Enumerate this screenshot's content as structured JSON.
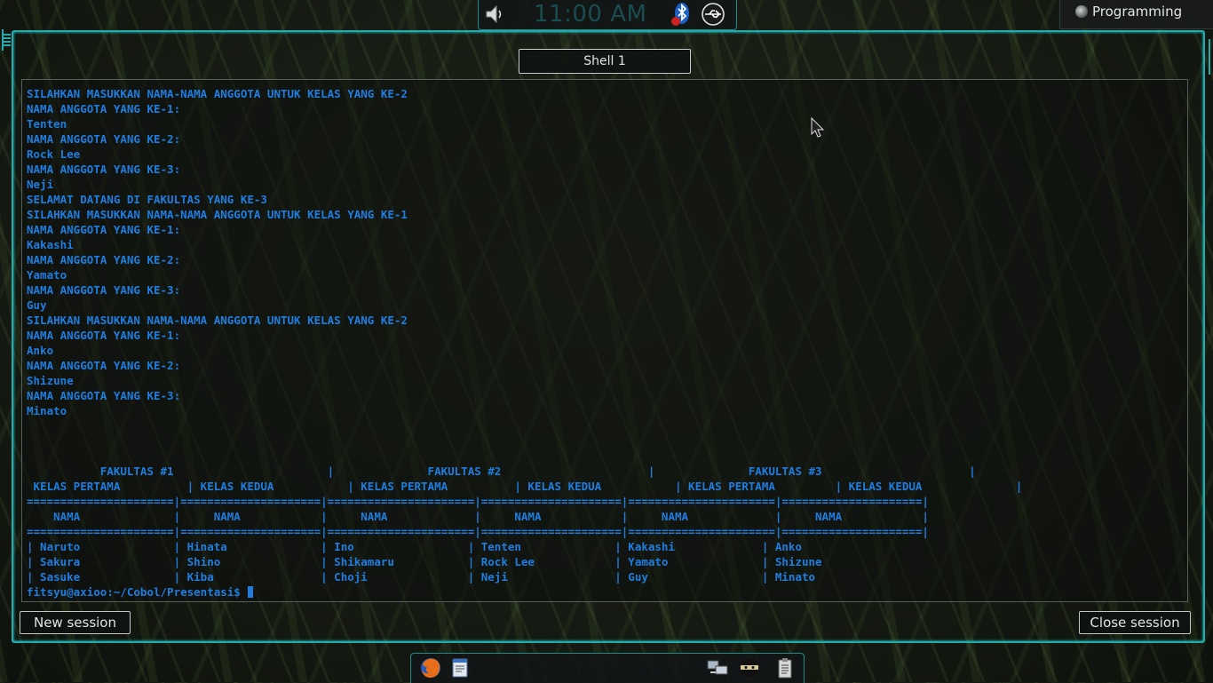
{
  "top_panel": {
    "clock": "11:00 AM",
    "icons": [
      "speaker-icon",
      "bluetooth-icon",
      "usb-icon"
    ]
  },
  "workspace": {
    "label": "Programming"
  },
  "konsole": {
    "tab_title": "Shell 1",
    "new_session_label": "New session",
    "close_session_label": "Close session",
    "terminal_output": "SILAHKAN MASUKKAN NAMA-NAMA ANGGOTA UNTUK KELAS YANG KE-2\nNAMA ANGGOTA YANG KE-1:\nTenten\nNAMA ANGGOTA YANG KE-2:\nRock Lee\nNAMA ANGGOTA YANG KE-3:\nNeji\nSELAMAT DATANG DI FAKULTAS YANG KE-3\nSILAHKAN MASUKKAN NAMA-NAMA ANGGOTA UNTUK KELAS YANG KE-1\nNAMA ANGGOTA YANG KE-1:\nKakashi\nNAMA ANGGOTA YANG KE-2:\nYamato\nNAMA ANGGOTA YANG KE-3:\nGuy\nSILAHKAN MASUKKAN NAMA-NAMA ANGGOTA UNTUK KELAS YANG KE-2\nNAMA ANGGOTA YANG KE-1:\nAnko\nNAMA ANGGOTA YANG KE-2:\nShizune\nNAMA ANGGOTA YANG KE-3:\nMinato\n\n\n\n           FAKULTAS #1                       |              FAKULTAS #2                      |              FAKULTAS #3                      |\n KELAS PERTAMA          | KELAS KEDUA           | KELAS PERTAMA          | KELAS KEDUA           | KELAS PERTAMA         | KELAS KEDUA              |\n======================|=====================|======================|=====================|======================|=====================|\n    NAMA              |     NAMA            |     NAMA             |     NAMA            |     NAMA             |     NAMA            |\n======================|=====================|======================|=====================|======================|=====================|\n| Naruto              | Hinata              | Ino                 | Tenten              | Kakashi             | Anko\n| Sakura              | Shino               | Shikamaru           | Rock Lee            | Yamato              | Shizune\n| Sasuke              | Kiba                | Choji               | Neji                | Guy                 | Minato",
    "prompt": "fitsyu@axioo:~/Cobol/Presentasi$ "
  },
  "dock": {
    "icons": [
      "firefox-icon",
      "notes-icon",
      "network-icon",
      "ninja-icon",
      "clipboard-icon"
    ]
  },
  "colors": {
    "terminal_text": "#1f7de0",
    "frame_accent": "#25a9ab",
    "clock_text": "#1a4c52"
  }
}
